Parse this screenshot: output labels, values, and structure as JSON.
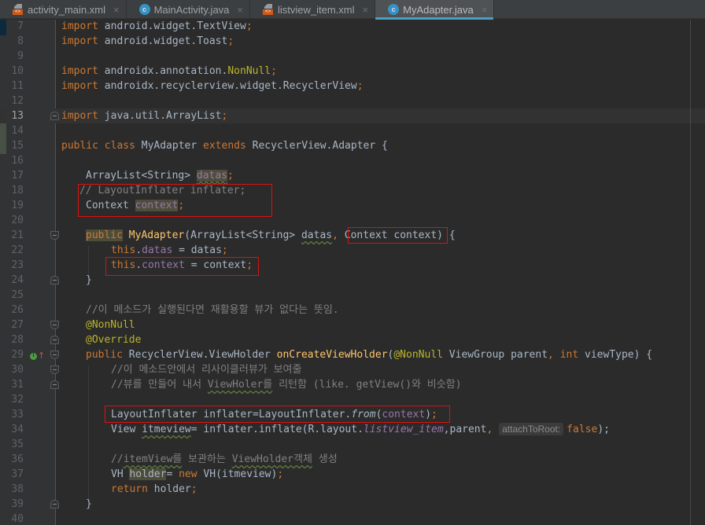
{
  "tabs": [
    {
      "label": "activity_main.xml",
      "icon": "xml-layout-icon",
      "active": false
    },
    {
      "label": "MainActivity.java",
      "icon": "java-class-icon",
      "active": false
    },
    {
      "label": "listview_item.xml",
      "icon": "xml-layout-icon",
      "active": false
    },
    {
      "label": "MyAdapter.java",
      "icon": "java-class-icon",
      "active": true
    }
  ],
  "tab_close_glyph": "×",
  "class_icon_letter": "c",
  "current_line": 13,
  "lines": {
    "7": {
      "num": "7",
      "t": [
        "import",
        " android.widget.TextView",
        ";"
      ]
    },
    "8": {
      "num": "8",
      "t": [
        "import",
        " android.widget.Toast",
        ";"
      ]
    },
    "9": {
      "num": "9"
    },
    "10": {
      "num": "10",
      "t": [
        "import",
        " androidx.annotation.",
        "NonNull",
        ";"
      ]
    },
    "11": {
      "num": "11",
      "t": [
        "import",
        " androidx.recyclerview.widget.RecyclerView",
        ";"
      ]
    },
    "12": {
      "num": "12"
    },
    "13": {
      "num": "13",
      "t": [
        "import",
        " java.util.ArrayList",
        ";"
      ]
    },
    "14": {
      "num": "14"
    },
    "15": {
      "num": "15",
      "t": [
        "public class",
        " MyAdapter ",
        "extends",
        " RecyclerView.Adapter {"
      ]
    },
    "16": {
      "num": "16"
    },
    "17": {
      "num": "17",
      "t": [
        "ArrayList<String> ",
        "datas",
        ";"
      ]
    },
    "18": {
      "num": "18",
      "t": [
        "// LayoutInflater inflater;"
      ]
    },
    "19": {
      "num": "19",
      "t": [
        "Context ",
        "context",
        ";"
      ]
    },
    "20": {
      "num": "20"
    },
    "21": {
      "num": "21",
      "t": [
        "public",
        " ",
        "MyAdapter",
        "(ArrayList<String> ",
        "datas",
        ",",
        " Context context",
        ") {"
      ]
    },
    "22": {
      "num": "22",
      "t": [
        "this",
        ".",
        "datas",
        " = datas",
        ";"
      ]
    },
    "23": {
      "num": "23",
      "t": [
        "this",
        ".",
        "context",
        " = context",
        ";"
      ]
    },
    "24": {
      "num": "24",
      "t": [
        "}"
      ]
    },
    "25": {
      "num": "25"
    },
    "26": {
      "num": "26",
      "t": [
        "//이 메소드가 실행된다면 재활용할 뷰가 없다는 뜻임."
      ]
    },
    "27": {
      "num": "27",
      "t": [
        "@NonNull"
      ]
    },
    "28": {
      "num": "28",
      "t": [
        "@Override"
      ]
    },
    "29": {
      "num": "29",
      "t": [
        "public",
        " RecyclerView.ViewHolder ",
        "onCreateViewHolder",
        "(",
        "@NonNull",
        " ViewGroup parent",
        ",",
        " ",
        "int",
        " viewType) {"
      ]
    },
    "30": {
      "num": "30",
      "t": [
        "//이 메소드안에서 리사이클러뷰가 보여줄"
      ]
    },
    "31": {
      "num": "31",
      "t": [
        "//뷰를 만들어 내서 ",
        "ViewHoler를",
        " 리턴함 (like. getView()와 비슷함)"
      ]
    },
    "32": {
      "num": "32"
    },
    "33": {
      "num": "33",
      "t": [
        "LayoutInflater inflater=LayoutInflater.",
        "from",
        "(",
        "context",
        ")",
        ";"
      ]
    },
    "34": {
      "num": "34",
      "t": [
        "View ",
        "itmeview",
        "= inflater.inflate(R.layout.",
        "listview_item",
        ",parent",
        ",",
        " ",
        "attachToRoot:",
        "false",
        ");"
      ]
    },
    "35": {
      "num": "35"
    },
    "36": {
      "num": "36",
      "t": [
        "//",
        "itemView를",
        " 보관하는 ",
        "ViewHolder객체",
        " 생성"
      ]
    },
    "37": {
      "num": "37",
      "t": [
        "VH ",
        "holder",
        "= ",
        "new",
        " VH(itmeview)",
        ";"
      ]
    },
    "38": {
      "num": "38",
      "t": [
        "return",
        " holder",
        ";"
      ]
    },
    "39": {
      "num": "39",
      "t": [
        "}"
      ]
    },
    "40": {
      "num": "40"
    }
  },
  "gutter_markers": {
    "29": {
      "implements_icon": "I",
      "override_arrow": "↑"
    }
  },
  "colors": {
    "background": "#2b2b2b",
    "keyword": "#cc7832",
    "annotation": "#bbb529",
    "comment": "#808080",
    "field": "#9876aa",
    "method": "#ffc66d",
    "text": "#a9b7c6",
    "highlight_box": "#e01010",
    "active_tab_underline": "#4a9fc5"
  }
}
